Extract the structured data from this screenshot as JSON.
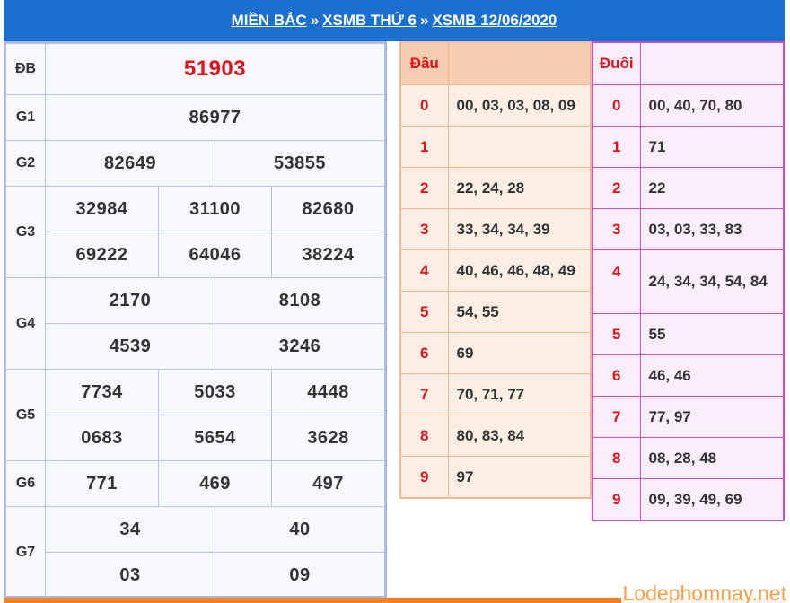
{
  "breadcrumb": {
    "items": [
      "MIỀN BẮC",
      "XSMB THỨ 6",
      "XSMB 12/06/2020"
    ],
    "separator": "»"
  },
  "results": {
    "db": {
      "label": "ĐB",
      "numbers": [
        "51903"
      ]
    },
    "g1": {
      "label": "G1",
      "numbers": [
        "86977"
      ]
    },
    "g2": {
      "label": "G2",
      "numbers": [
        "82649",
        "53855"
      ]
    },
    "g3": {
      "label": "G3",
      "numbers": [
        "32984",
        "31100",
        "82680",
        "69222",
        "64046",
        "38224"
      ]
    },
    "g4": {
      "label": "G4",
      "numbers": [
        "2170",
        "8108",
        "4539",
        "3246"
      ]
    },
    "g5": {
      "label": "G5",
      "numbers": [
        "7734",
        "5033",
        "4448",
        "0683",
        "5654",
        "3628"
      ]
    },
    "g6": {
      "label": "G6",
      "numbers": [
        "771",
        "469",
        "497"
      ]
    },
    "g7": {
      "label": "G7",
      "numbers": [
        "34",
        "40",
        "03",
        "09"
      ]
    }
  },
  "dau": {
    "title": "Đầu",
    "rows": [
      {
        "k": "0",
        "v": "00, 03, 03, 08, 09"
      },
      {
        "k": "1",
        "v": ""
      },
      {
        "k": "2",
        "v": "22, 24, 28"
      },
      {
        "k": "3",
        "v": "33, 34, 34, 39"
      },
      {
        "k": "4",
        "v": "40, 46, 46, 48, 49"
      },
      {
        "k": "5",
        "v": "54, 55"
      },
      {
        "k": "6",
        "v": "69"
      },
      {
        "k": "7",
        "v": "70, 71, 77"
      },
      {
        "k": "8",
        "v": "80, 83, 84"
      },
      {
        "k": "9",
        "v": "97"
      }
    ]
  },
  "duoi": {
    "title": "Đuôi",
    "rows": [
      {
        "k": "0",
        "v": "00, 40, 70, 80"
      },
      {
        "k": "1",
        "v": "71"
      },
      {
        "k": "2",
        "v": "22"
      },
      {
        "k": "3",
        "v": "03, 03, 33, 83"
      },
      {
        "k": "4",
        "v": "24, 34, 34, 54, 84"
      },
      {
        "k": "5",
        "v": "55"
      },
      {
        "k": "6",
        "v": "46, 46"
      },
      {
        "k": "7",
        "v": "77, 97"
      },
      {
        "k": "8",
        "v": "08, 28, 48"
      },
      {
        "k": "9",
        "v": "09, 39, 49, 69"
      }
    ]
  },
  "watermark": "Lodephomnay.net",
  "colors": {
    "header": "#1b6fcf",
    "special": "#e2101a",
    "dau_border": "#f2b995",
    "duoi_border": "#d04fbe",
    "accent_bar": "#f58220"
  }
}
